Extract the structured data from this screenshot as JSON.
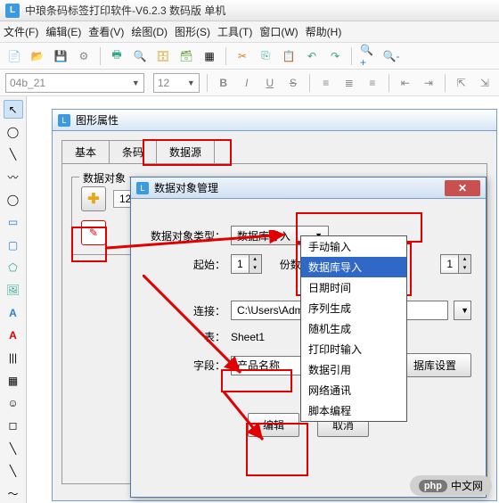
{
  "window": {
    "title": "中琅条码标签打印软件-V6.2.3 数码版 单机"
  },
  "menu": {
    "file": "文件(F)",
    "edit": "编辑(E)",
    "view": "查看(V)",
    "draw": "绘图(D)",
    "shape": "图形(S)",
    "tool": "工具(T)",
    "window": "窗口(W)",
    "help": "帮助(H)"
  },
  "toolbar2": {
    "font_value": "04b_21",
    "size_value": "12"
  },
  "panel_props": {
    "title": "图形属性",
    "tabs": {
      "basic": "基本",
      "barcode": "条码",
      "datasource": "数据源"
    },
    "group_label": "数据对象",
    "text_value": "12"
  },
  "dialog": {
    "title": "数据对象管理",
    "type_label": "数据对象类型：",
    "type_value": "数据库导入",
    "start_label": "起始：",
    "start_value": "1",
    "copies_label": "份数",
    "copies_value": "1",
    "conn_label": "连接：",
    "conn_value": "C:\\Users\\Admi...",
    "table_label": "表：",
    "table_value": "Sheet1",
    "field_label": "字段：",
    "field_value": "产品名称",
    "dbset_btn": "据库设置",
    "edit_btn": "编辑",
    "cancel_btn": "取消",
    "dropdown_options": [
      "手动输入",
      "数据库导入",
      "日期时间",
      "序列生成",
      "随机生成",
      "打印时输入",
      "数据引用",
      "网络通讯",
      "脚本编程"
    ]
  },
  "logo": {
    "prefix": "php",
    "text": "中文网"
  }
}
